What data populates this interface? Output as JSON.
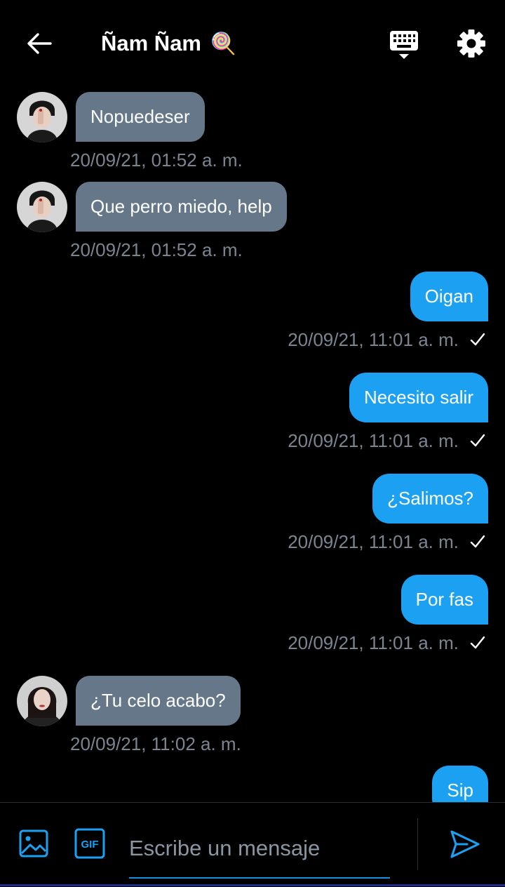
{
  "header": {
    "title": "Ñam Ñam",
    "title_emoji": "🍭",
    "back_icon": "arrow-left-icon",
    "keyboard_icon": "keyboard-hide-icon",
    "settings_icon": "gear-icon"
  },
  "messages": [
    {
      "text": "Nopuedeser",
      "time": "20/09/21, 01:52 a. m."
    },
    {
      "text": "Que perro miedo, help",
      "time": "20/09/21, 01:52 a. m."
    },
    {
      "text": "Oigan",
      "time": "20/09/21, 11:01 a. m."
    },
    {
      "text": "Necesito salir",
      "time": "20/09/21, 11:01 a. m."
    },
    {
      "text": "¿Salimos?",
      "time": "20/09/21, 11:01 a. m."
    },
    {
      "text": "Por fas",
      "time": "20/09/21, 11:01 a. m."
    },
    {
      "text": "¿Tu celo acabo?",
      "time": "20/09/21, 11:02 a. m."
    },
    {
      "text": "Sip"
    }
  ],
  "composer": {
    "placeholder": "Escribe un mensaje",
    "value": "",
    "gif_label": "GIF",
    "image_icon": "image-icon",
    "send_icon": "send-icon"
  },
  "colors": {
    "background": "#000000",
    "incoming_bubble": "#657789",
    "outgoing_bubble": "#1ca1f2",
    "timestamp": "#7a8591",
    "accent": "#1c8ee0"
  }
}
